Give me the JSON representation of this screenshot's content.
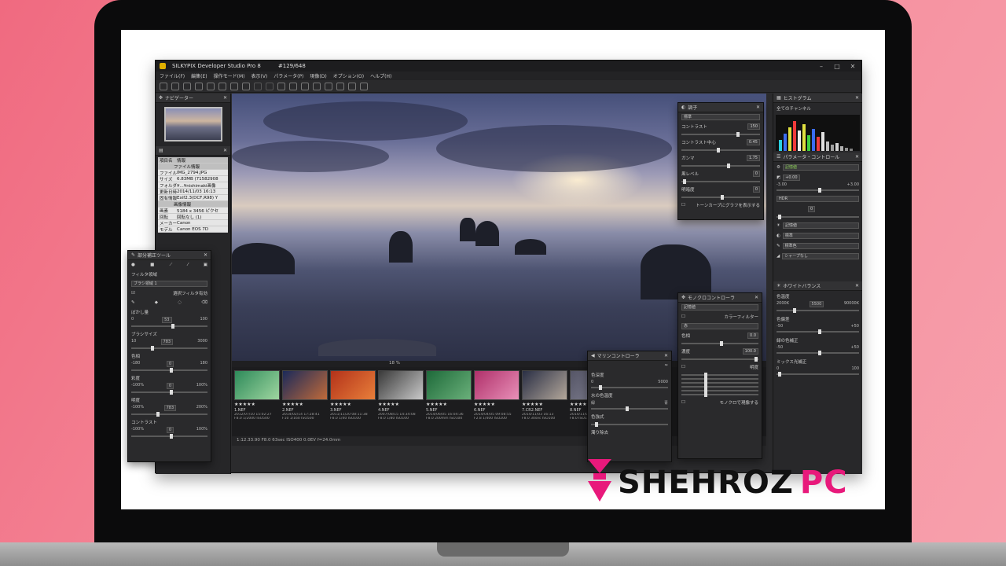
{
  "app": {
    "title": "SILKYPIX Developer Studio Pro 8",
    "counter": "#129/648",
    "menu": [
      "ファイル(F)",
      "編集(E)",
      "操作モード(M)",
      "表示(V)",
      "パラメータ(P)",
      "現像(D)",
      "オプション(O)",
      "ヘルプ(H)"
    ]
  },
  "navigator": {
    "title": "ナビゲーター"
  },
  "info_table": {
    "header": [
      "項目名",
      "情報"
    ],
    "section_file": "ファイル情報",
    "rows": [
      {
        "k": "ファイル",
        "v": "IMG_2794.JPG"
      },
      {
        "k": "サイズ",
        "v": "6.83MB (71582908"
      },
      {
        "k": "フォルダ",
        "v": "¥...¥nishimaki画像"
      },
      {
        "k": "更新日時",
        "v": "2014/11/03 16:13"
      },
      {
        "k": "固有情報",
        "v": "Exif2.3(DCF,R98) Y"
      }
    ],
    "section_image": "画像情報",
    "rows2": [
      {
        "k": "画素",
        "v": "5184 x 3456 ピクセ"
      },
      {
        "k": "回転",
        "v": "回転なし (1)"
      },
      {
        "k": "メーカー",
        "v": "Canon"
      },
      {
        "k": "モデル",
        "v": "Canon EOS 7D"
      }
    ]
  },
  "partial_tool": {
    "title": "部分補正ツール",
    "filter_area": "フィルタ領域",
    "brush_placeholder": "ブラシ領域 1",
    "select_filter": "選択フィルタ有効",
    "blur_amount": "ぼかし量",
    "blur_min": "0",
    "blur_val": "53",
    "blur_max": "100",
    "brush_size": "ブラシサイズ",
    "size_min": "10",
    "size_val": "783",
    "size_max": "3000",
    "hue": "色相",
    "hue_min": "-180",
    "hue_val": "0",
    "hue_max": "180",
    "sat": "彩度",
    "sat_min": "-100%",
    "sat_val": "0",
    "sat_max": "100%",
    "bright": "明度",
    "bright_min": "-100%",
    "bright_val": "783",
    "bright_max": "200%",
    "contrast": "コントラスト",
    "con_min": "-100%",
    "con_val": "0",
    "con_max": "100%"
  },
  "tone_panel": {
    "title": "調子",
    "preset": "標準",
    "rows": [
      {
        "label": "コントラスト",
        "value": "150"
      },
      {
        "label": "コントラスト中心",
        "value": "0.45"
      },
      {
        "label": "ガンマ",
        "value": "1.75"
      },
      {
        "label": "黒レベル",
        "value": "0"
      },
      {
        "label": "明暗度",
        "value": "0"
      }
    ],
    "tonecurve": "トーンカーブにグラフを表示する"
  },
  "mono_panel": {
    "title": "モノクロコントローラ",
    "preset": "記憶値",
    "color_filter": "カラーフィルター",
    "filter_val": "赤",
    "hue_label": "色相",
    "hue_val": "0.0",
    "density_label": "濃度",
    "density_val": "100.0",
    "fine": "明度",
    "show_mono": "モノクロで現像する"
  },
  "marine_panel": {
    "title": "マリンコントローラ",
    "depth_label": "色深度",
    "depth_min": "0",
    "depth_max": "5000",
    "water_label": "水の色温度",
    "green": "緑",
    "blue": "青",
    "color_label": "色強式",
    "extra": "濁り除去"
  },
  "right_panel": {
    "histogram_title": "ヒストグラム",
    "channel": "全てのチャンネル",
    "param_title": "パラメータ・コントロール",
    "recall": "記憶値",
    "exposure_val": "+0.00",
    "exp_min": "-3.00",
    "exp_max": "+3.00",
    "hdr": "HDR",
    "hdr_val": "0",
    "dropdowns": [
      "記憶値",
      "標準",
      "標準色",
      "シャープなし"
    ],
    "wb_title": "ホワイトバランス",
    "temp_label": "色温度",
    "temp_min": "2000K",
    "temp_val": "5500",
    "temp_max": "90000K",
    "tint_label": "色偏差",
    "tint_min": "-50",
    "tint_max": "+50",
    "green_label": "緑の色補正",
    "green_min": "-50",
    "green_max": "+50",
    "mix_label": "ミックス光補正",
    "mix_min": "0",
    "mix_max": "100"
  },
  "filmstrip": [
    {
      "name": "1.NEF",
      "date": "2012/07/10 15:02:27",
      "exp": "F8.0 1/2000 ISO500",
      "stars": "★★★★★",
      "c1": "#2e8a5a",
      "c2": "#9fd6a0"
    },
    {
      "name": "2.NEF",
      "date": "2014/02/14 17:28:41",
      "exp": "F10 1/160 ISO500",
      "stars": "★★★★★",
      "c1": "#1b2a5a",
      "c2": "#c06a3a"
    },
    {
      "name": "3.NEF",
      "date": "2011/11/20 08:11:38",
      "exp": "F8.0 1/40 ISO100",
      "stars": "★★★★★",
      "c1": "#b3321a",
      "c2": "#e87f3a"
    },
    {
      "name": "4.NEF",
      "date": "2007/08/15 14:34:08",
      "exp": "F8.0 1/80 ISO100",
      "stars": "★★★★★",
      "c1": "#3a3a3a",
      "c2": "#c9c9c9"
    },
    {
      "name": "5.NEF",
      "date": "2014/06/05 16:04:36",
      "exp": "F8.0 200mm ISO100",
      "stars": "★★★★★",
      "c1": "#1e6a3a",
      "c2": "#6ab07a"
    },
    {
      "name": "6.NEF",
      "date": "2014/04/05 09:08:55",
      "exp": "F2.8 1/400 ISO200",
      "stars": "★★★★★",
      "c1": "#b0306a",
      "c2": "#e890b8"
    },
    {
      "name": "7.CR2.NEF",
      "date": "2014/11/03 16:13",
      "exp": "F8.0 30sec ISO100",
      "stars": "★★★★★",
      "c1": "#2a2f45",
      "c2": "#b3a79a"
    },
    {
      "name": "8.NEF",
      "date": "2014/11/03",
      "exp": "F8.0 ISO100",
      "stars": "★★★★★",
      "c1": "#556",
      "c2": "#889"
    }
  ],
  "zoom_label": "18 %",
  "statusbar": "1:12.33.90 F8.0 63sec ISO400  0.0EV f=24.0mm",
  "brand": {
    "part1": "SHEHROZ",
    "part2": "PC"
  }
}
